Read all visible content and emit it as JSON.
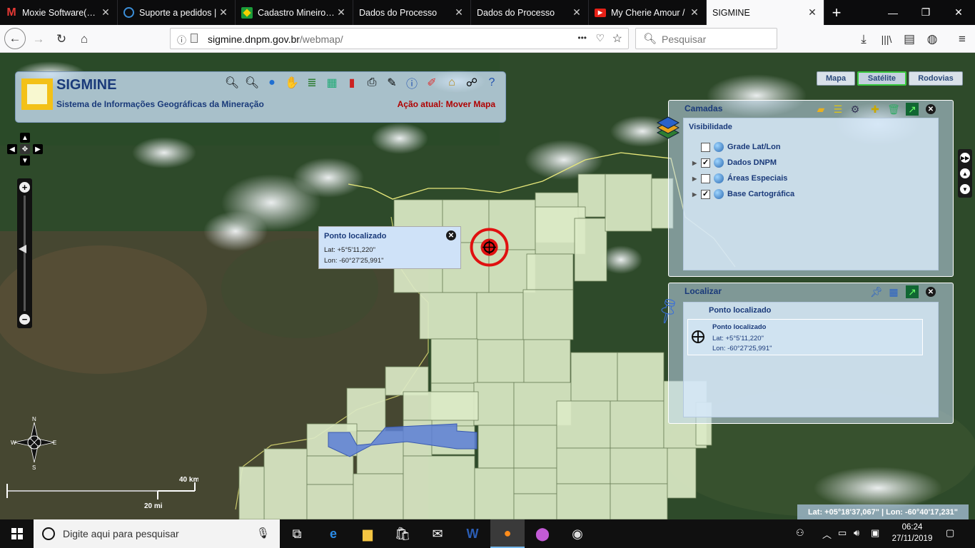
{
  "browser": {
    "tabs": [
      {
        "title": "Moxie Software(TM)",
        "icon": "gmail-m-icon",
        "active": false
      },
      {
        "title": "Suporte a pedidos |",
        "icon": "dell-icon",
        "active": false
      },
      {
        "title": "Cadastro Mineiro —",
        "icon": "brazil-flag-icon",
        "active": false
      },
      {
        "title": "Dados do Processo",
        "icon": "",
        "active": false
      },
      {
        "title": "Dados do Processo",
        "icon": "",
        "active": false
      },
      {
        "title": "My Cherie Amour /",
        "icon": "youtube-icon",
        "active": false
      },
      {
        "title": "SIGMINE",
        "icon": "",
        "active": true
      }
    ],
    "url_domain": "sigmine.dnpm.gov.br",
    "url_path": "/webmap/",
    "search_placeholder": "Pesquisar",
    "menu_dots": "•••"
  },
  "app": {
    "title": "SIGMINE",
    "subtitle": "Sistema de Informações Geográficas da Mineração",
    "current_action": "Ação atual: Mover Mapa"
  },
  "map_types": {
    "mapa": "Mapa",
    "satelite": "Satélite",
    "rodovias": "Rodovias",
    "selected": "Satélite"
  },
  "popup": {
    "title": "Ponto localizado",
    "lat": "Lat: +5°5'11,220\"",
    "lon": "Lon: -60°27'25,991\""
  },
  "layers_panel": {
    "title": "Camadas",
    "section": "Visibilidade",
    "items": [
      {
        "label": "Grade Lat/Lon",
        "checked": false,
        "expandable": false
      },
      {
        "label": "Dados DNPM",
        "checked": true,
        "expandable": true
      },
      {
        "label": "Áreas Especiais",
        "checked": false,
        "expandable": true
      },
      {
        "label": "Base Cartográfica",
        "checked": true,
        "expandable": true
      }
    ]
  },
  "locate_panel": {
    "title": "Localizar",
    "section": "Ponto localizado",
    "entry_title": "Ponto localizado",
    "lat": "Lat: +5°5'11,220\"",
    "lon": "Lon: -60°27'25,991\""
  },
  "status": {
    "coords": "Lat: +05°18'37,067\" | Lon: -60°40'17,231\""
  },
  "scale": {
    "km": "40 km",
    "mi": "20 mi"
  },
  "compass": {
    "n": "N",
    "s": "S",
    "e": "E",
    "w": "W"
  },
  "taskbar": {
    "search_placeholder": "Digite aqui para pesquisar",
    "time": "06:24",
    "date": "27/11/2019"
  },
  "colors": {
    "app_title": "#1a3a7a",
    "action_text": "#b00000",
    "selected_border": "#39c93e",
    "claim_fill": "#dbe9c6",
    "special_area_fill": "#5c7fd6",
    "marker_red": "#e01010"
  }
}
